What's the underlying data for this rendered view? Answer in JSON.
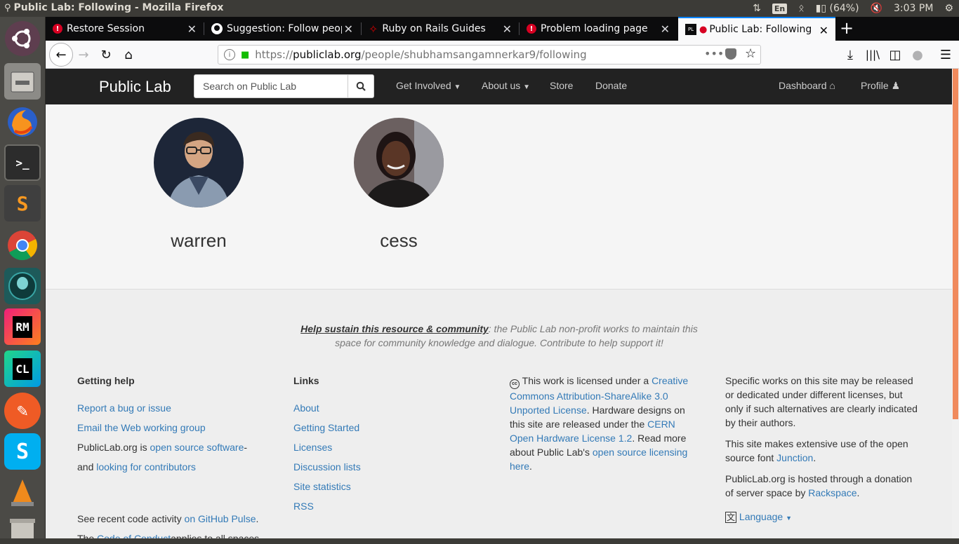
{
  "system": {
    "window_title": "Public Lab: Following - Mozilla Firefox",
    "keyboard": "En",
    "battery": "(64%)",
    "time": "3:03 PM"
  },
  "browser": {
    "tabs": [
      {
        "label": "Restore Session",
        "icon": "error-icon"
      },
      {
        "label": "Suggestion: Follow peop",
        "icon": "github-icon"
      },
      {
        "label": "Ruby on Rails Guides",
        "icon": "rails-icon"
      },
      {
        "label": "Problem loading page",
        "icon": "error-icon"
      },
      {
        "label": "Public Lab: Following",
        "icon": "publiclab-icon"
      }
    ],
    "url_scheme": "https://",
    "url_host": "publiclab.org",
    "url_path": "/people/shubhamsangamnerkar9/following"
  },
  "site": {
    "brand": "Public Lab",
    "search_placeholder": "Search on Public Lab",
    "nav": {
      "get_involved": "Get Involved",
      "about_us": "About us",
      "store": "Store",
      "donate": "Donate",
      "dashboard": "Dashboard",
      "profile": "Profile"
    }
  },
  "following": [
    {
      "name": "warren"
    },
    {
      "name": "cess"
    }
  ],
  "footer": {
    "sustain_link": "Help sustain this resource & community",
    "sustain_text": ": the Public Lab non-profit works to maintain this space for community knowledge and dialogue. Contribute to help support it!",
    "getting_help": {
      "heading": "Getting help",
      "report": "Report a bug or issue",
      "email": "Email the Web working group",
      "oss_prefix": "PublicLab.org is ",
      "oss_link": "open source software",
      "oss_mid": " -",
      "and": "and ",
      "contrib_link": "looking for contributors",
      "recent": "See recent code activity ",
      "pulse_link": "on GitHub Pulse",
      "period": ".",
      "coc_prefix": "The ",
      "coc_link": "Code of Conduct",
      "coc_suffix": " applies to all spaces"
    },
    "links": {
      "heading": "Links",
      "items": [
        "About",
        "Getting Started",
        "Licenses",
        "Discussion lists",
        "Site statistics",
        "RSS"
      ]
    },
    "license": {
      "p1": "This work is licensed under a ",
      "cc_link": "Creative Commons Attribution-ShareAlike 3.0 Unported License",
      "p2": ". Hardware designs on this site are released under the ",
      "cern_link": "CERN Open Hardware License 1.2",
      "p3": ". Read more about Public Lab's ",
      "oss_link": "open source licensing here",
      "p4": "."
    },
    "other": {
      "specific": "Specific works on this site may be released or dedicated under different licenses, but only if such alternatives are clearly indicated by their authors.",
      "font_prefix": "This site makes extensive use of the open source font ",
      "font_link": "Junction",
      "font_suffix": ".",
      "hosted_prefix": "PublicLab.org is hosted through a donation of server space by ",
      "rackspace_link": "Rackspace",
      "hosted_suffix": ".",
      "language": "Language"
    }
  }
}
